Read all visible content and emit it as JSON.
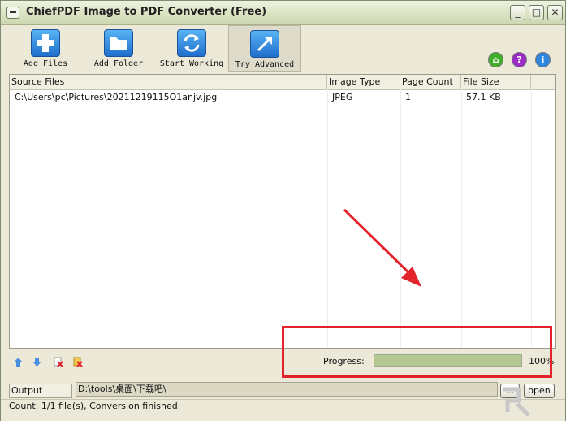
{
  "window": {
    "title": "ChiefPDF Image to PDF Converter (Free)"
  },
  "title_buttons": {
    "minimize": "_",
    "maximize": "□",
    "close": "✕"
  },
  "toolbar": {
    "buttons": [
      {
        "label": "Add Files",
        "icon": "add-files-icon"
      },
      {
        "label": "Add Folder",
        "icon": "folder-icon"
      },
      {
        "label": "Start Working",
        "icon": "refresh-icon"
      },
      {
        "label": "Try Advanced",
        "icon": "advanced-arrow-icon"
      }
    ],
    "right_icons": [
      {
        "icon": "home-icon",
        "glyph": "⌂",
        "color": "#3fae2a"
      },
      {
        "icon": "help-icon",
        "glyph": "?",
        "color": "#9a2bc4"
      },
      {
        "icon": "info-icon",
        "glyph": "i",
        "color": "#2e86de"
      }
    ]
  },
  "table": {
    "columns": [
      "Source Files",
      "Image Type",
      "Page Count",
      "File Size"
    ],
    "rows": [
      {
        "source": "C:\\Users\\pc\\Pictures\\20211219115O1anjv.jpg",
        "type": "JPEG",
        "pages": "1",
        "size": "57.1 KB"
      }
    ]
  },
  "progress": {
    "label": "Progress:",
    "value": 100,
    "text": "100%"
  },
  "output": {
    "label": "Output Folder:",
    "path": "D:\\tools\\桌面\\下载吧\\",
    "browse_label": "...",
    "open_label": "open"
  },
  "status": {
    "text": "Count:  1/1 file(s),  Conversion finished."
  },
  "colors": {
    "accent_red": "#e3232c",
    "progress_fill": "#b4c992"
  }
}
